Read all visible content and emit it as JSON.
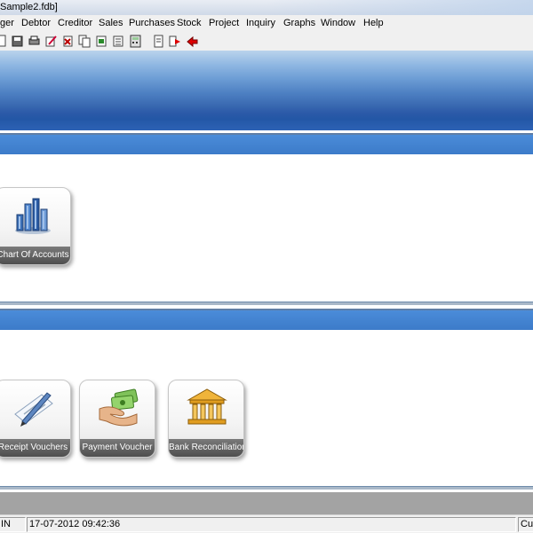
{
  "window": {
    "title": "Sample2.fdb]"
  },
  "menu": {
    "items": [
      {
        "label": "ger"
      },
      {
        "label": "Debtor"
      },
      {
        "label": "Creditor"
      },
      {
        "label": "Sales"
      },
      {
        "label": "Purchases"
      },
      {
        "label": "Stock"
      },
      {
        "label": "Project"
      },
      {
        "label": "Inquiry"
      },
      {
        "label": "Graphs"
      },
      {
        "label": "Window"
      },
      {
        "label": "Help"
      }
    ]
  },
  "toolbar": {
    "icons": [
      "new-icon",
      "save-icon",
      "print-setup-icon",
      "edit-icon",
      "delete-icon",
      "copy-icon",
      "export-icon",
      "report-icon",
      "calculator-icon",
      "document-icon",
      "forward-icon",
      "exit-icon"
    ]
  },
  "sections": [
    {
      "tiles": [
        {
          "label": "Chart Of Accounts",
          "icon": "bar-chart-icon"
        }
      ]
    },
    {
      "tiles": [
        {
          "label": "Receipt Vouchers",
          "icon": "pen-paper-icon"
        },
        {
          "label": "Payment Voucher",
          "icon": "cash-hand-icon"
        },
        {
          "label": "Bank Reconciliation",
          "icon": "bank-icon"
        }
      ]
    }
  ],
  "status": {
    "user": "IN",
    "datetime": "17-07-2012 09:42:36",
    "right": "Cur"
  },
  "colors": {
    "section_bar": "#3c7bc9",
    "banner_dark": "#2357a6",
    "tile_label_bg": "#5a5a5a"
  }
}
